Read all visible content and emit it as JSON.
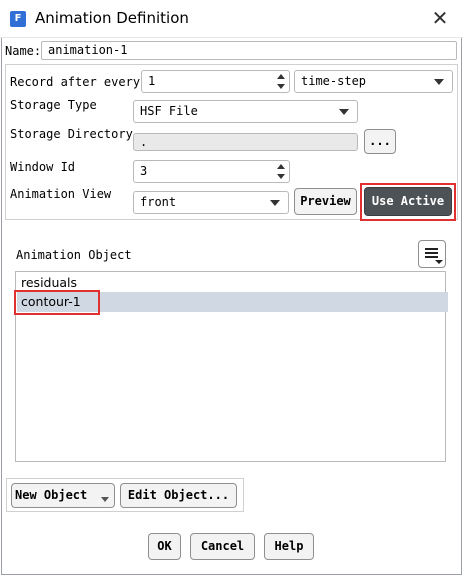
{
  "window": {
    "app_icon": "F",
    "title": "Animation Definition",
    "close_glyph": "✕"
  },
  "name": {
    "label": "Name:",
    "value": "animation-1"
  },
  "record": {
    "label": "Record after every",
    "value": "1",
    "unit_value": "time-step"
  },
  "storage_type": {
    "label": "Storage Type",
    "value": "HSF File"
  },
  "storage_directory": {
    "label": "Storage Directory",
    "value": ".",
    "browse_label": "..."
  },
  "window_id": {
    "label": "Window Id",
    "value": "3"
  },
  "animation_view": {
    "label": "Animation View",
    "value": "front",
    "preview_label": "Preview",
    "use_active_label": "Use Active"
  },
  "animation_object": {
    "label": "Animation Object",
    "menu_icon": "hamburger-menu-icon",
    "items": [
      "residuals",
      "contour-1"
    ],
    "selected_index": 1
  },
  "object_buttons": {
    "new_label": "New Object",
    "edit_label": "Edit Object..."
  },
  "footer": {
    "ok_label": "OK",
    "cancel_label": "Cancel",
    "help_label": "Help"
  },
  "colors": {
    "use_active_bg": "#4d5257",
    "selection_bg": "#cfd8e3",
    "highlight_border": "#e03030",
    "app_icon_bg": "#2f6fd6"
  }
}
